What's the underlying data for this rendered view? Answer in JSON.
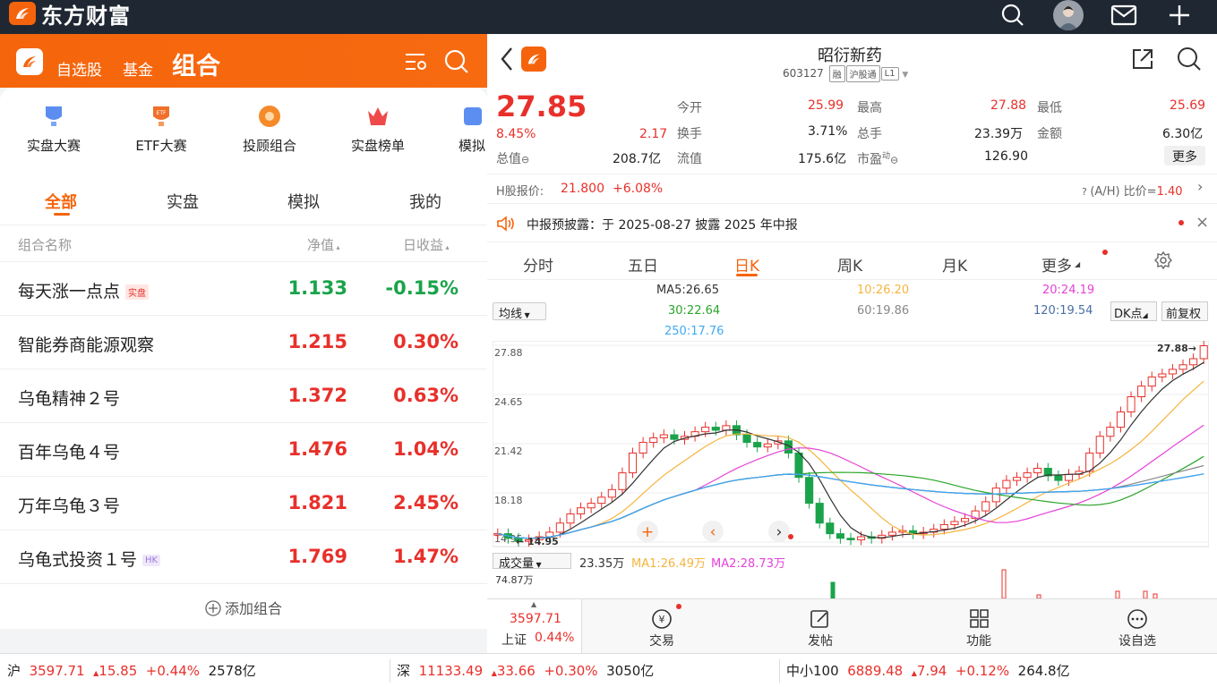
{
  "topbar": {
    "brand": "东方财富"
  },
  "left": {
    "header": {
      "tab1": "自选股",
      "tab2": "基金",
      "tab3": "组合"
    },
    "cards": [
      {
        "label": "实盘大赛",
        "icon": "trophy-icon"
      },
      {
        "label": "ETF大赛",
        "icon": "etf-trophy-icon"
      },
      {
        "label": "投顾组合",
        "icon": "advisor-icon"
      },
      {
        "label": "实盘榜单",
        "icon": "crown-icon"
      },
      {
        "label": "模拟",
        "icon": "sim-icon"
      }
    ],
    "tabs": [
      "全部",
      "实盘",
      "模拟",
      "我的"
    ],
    "columns": {
      "name": "组合名称",
      "nav": "净值",
      "daily": "日收益"
    },
    "rows": [
      {
        "name": "每天涨一点点",
        "tag": "实盘",
        "nav": "1.133",
        "daily": "-0.15%",
        "dir": "down"
      },
      {
        "name": "智能券商能源观察",
        "tag": "",
        "nav": "1.215",
        "daily": "0.30%",
        "dir": "up"
      },
      {
        "name": "乌龟精神２号",
        "tag": "",
        "nav": "1.372",
        "daily": "0.63%",
        "dir": "up"
      },
      {
        "name": "百年乌龟４号",
        "tag": "",
        "nav": "1.476",
        "daily": "1.04%",
        "dir": "up"
      },
      {
        "name": "万年乌龟３号",
        "tag": "",
        "nav": "1.821",
        "daily": "2.45%",
        "dir": "up"
      },
      {
        "name": "乌龟式投资１号",
        "tag": "HK",
        "nav": "1.769",
        "daily": "1.47%",
        "dir": "up"
      }
    ],
    "add_label": "添加组合"
  },
  "stock": {
    "name": "昭衍新药",
    "code": "603127",
    "tags": [
      "融",
      "沪股通",
      "L1"
    ],
    "price": "27.85",
    "pct": "8.45%",
    "chg": "2.17",
    "fields": {
      "open_l": "今开",
      "open": "25.99",
      "high_l": "最高",
      "high": "27.88",
      "low_l": "最低",
      "low": "25.69",
      "turn_l": "换手",
      "turn": "3.71%",
      "vol_l": "总手",
      "vol": "23.39万",
      "amt_l": "金额",
      "amt": "6.30亿",
      "mcap_l": "总值",
      "mcap": "208.7亿",
      "float_l": "流值",
      "float": "175.6亿",
      "pe_l": "市盈",
      "pe_sup": "动",
      "pe": "126.90",
      "more": "更多"
    },
    "hshare": {
      "label": "H股报价:",
      "price": "21.800",
      "pct": "+6.08%",
      "ratio_label": "(A/H) 比价=",
      "ratio": "1.40"
    },
    "notice": "中报预披露：于 2025-08-27 披露 2025 年中报",
    "ktabs": [
      "分时",
      "五日",
      "日K",
      "周K",
      "月K",
      "更多"
    ],
    "ma": {
      "sel": "均线",
      "ma5": "MA5:26.65",
      "ma10": "10:26.20",
      "ma20": "20:24.19",
      "ma30": "30:22.64",
      "ma60": "60:19.86",
      "ma120": "120:19.54",
      "ma250": "250:17.76",
      "dk": "DK点",
      "fq": "前复权"
    },
    "vol": {
      "sel": "成交量",
      "v": "23.35万",
      "ma1": "MA1:26.49万",
      "ma2": "MA2:28.73万",
      "max": "74.87万"
    },
    "index": {
      "price": "3597.71",
      "name": "上证",
      "pct": "0.44%"
    },
    "nav": [
      "交易",
      "发帖",
      "功能",
      "设自选"
    ]
  },
  "chart_data": {
    "type": "candlestick",
    "y_ticks": [
      "27.88",
      "24.65",
      "21.42",
      "18.18",
      "14.95"
    ],
    "ylim": [
      14.95,
      27.88
    ],
    "high_label": "27.88",
    "low_label": "14.95",
    "close_series": [
      15.5,
      15.2,
      15.0,
      15.1,
      15.3,
      15.6,
      16.2,
      16.8,
      17.2,
      17.5,
      17.9,
      18.4,
      19.5,
      20.8,
      21.5,
      21.8,
      22.0,
      21.7,
      21.9,
      22.2,
      22.5,
      22.3,
      22.6,
      22.0,
      21.5,
      21.2,
      21.4,
      21.6,
      20.8,
      19.2,
      17.5,
      16.2,
      15.5,
      15.2,
      15.1,
      15.3,
      15.2,
      15.4,
      15.6,
      15.7,
      15.5,
      15.6,
      15.8,
      16.1,
      16.3,
      16.5,
      17.0,
      17.6,
      18.5,
      19.0,
      19.2,
      19.5,
      19.8,
      19.3,
      19.0,
      19.4,
      19.6,
      20.8,
      21.9,
      22.5,
      23.5,
      24.5,
      25.2,
      25.8,
      26.0,
      26.3,
      26.6,
      27.0,
      27.85
    ]
  },
  "ticker": [
    {
      "name": "沪",
      "price": "3597.71",
      "chg": "15.85",
      "pct": "+0.44%",
      "amt": "2578亿"
    },
    {
      "name": "深",
      "price": "11133.49",
      "chg": "33.66",
      "pct": "+0.30%",
      "amt": "3050亿"
    },
    {
      "name": "中小100",
      "price": "6889.48",
      "chg": "7.94",
      "pct": "+0.12%",
      "amt": "264.8亿"
    }
  ]
}
